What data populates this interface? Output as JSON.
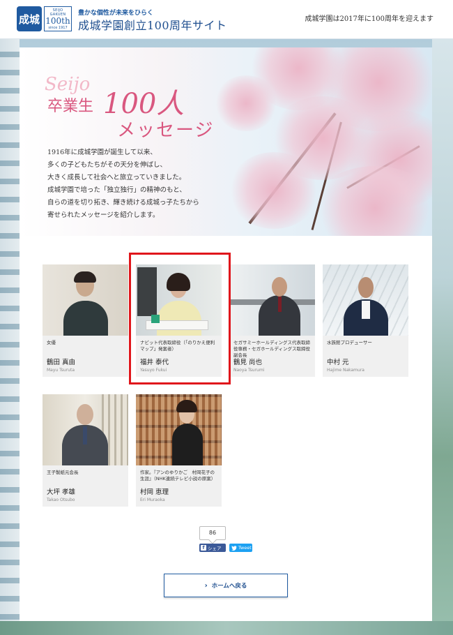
{
  "header": {
    "emblem_text": "成城",
    "badge_top": "SEIJO GAKUEN",
    "badge_main": "100th",
    "badge_bottom": "since 1917",
    "tagline": "豊かな個性が未来をひらく",
    "title": "成城学園創立100周年サイト",
    "note": "成城学園は2017年に100周年を迎えます"
  },
  "hero": {
    "script": "Seijo",
    "title_part1": "卒業生",
    "title_100": "100人",
    "title_part2": "メッセージ",
    "body_lines": [
      "1916年に成城学園が誕生して以来、",
      "多くの子どもたちがその天分を伸ばし、",
      "大きく成長して社会へと旅立っていきました。",
      "成城学園で培った「独立独行」の精神のもと、",
      "自らの道を切り拓き、輝き続ける成城っ子たちから",
      "寄せられたメッセージを紹介します。"
    ]
  },
  "people": [
    {
      "role": "女優",
      "name": "鶴田 真由",
      "roman": "Mayu Tsuruta"
    },
    {
      "role": "ナビット代表取締役（「のりかえ便利マップ」発案者）",
      "name": "福井 泰代",
      "roman": "Yasuyo Fukui"
    },
    {
      "role": "セガサミーホールディングス代表取締役専務・セガホールディングス取締役副会長",
      "name": "鶴見 尚也",
      "roman": "Naoya Tsurumi"
    },
    {
      "role": "水族館プロデューサー",
      "name": "中村 元",
      "roman": "Hajime Nakamura"
    },
    {
      "role": "王子製紙元会長",
      "name": "大坪 孝雄",
      "roman": "Takao Otsubo"
    },
    {
      "role": "作家。『アンのゆりかご　村岡花子の生涯』（NHK連続テレビ小説の原案）",
      "name": "村岡 恵理",
      "roman": "Eri Muraoka"
    }
  ],
  "share": {
    "count": "86",
    "facebook_label": "シェア",
    "twitter_label": "Tweet"
  },
  "home_button": "ホームへ戻る",
  "colors": {
    "brand_blue": "#1f5aa0",
    "accent_pink": "#d9577f",
    "highlight_red": "#e0161b"
  }
}
